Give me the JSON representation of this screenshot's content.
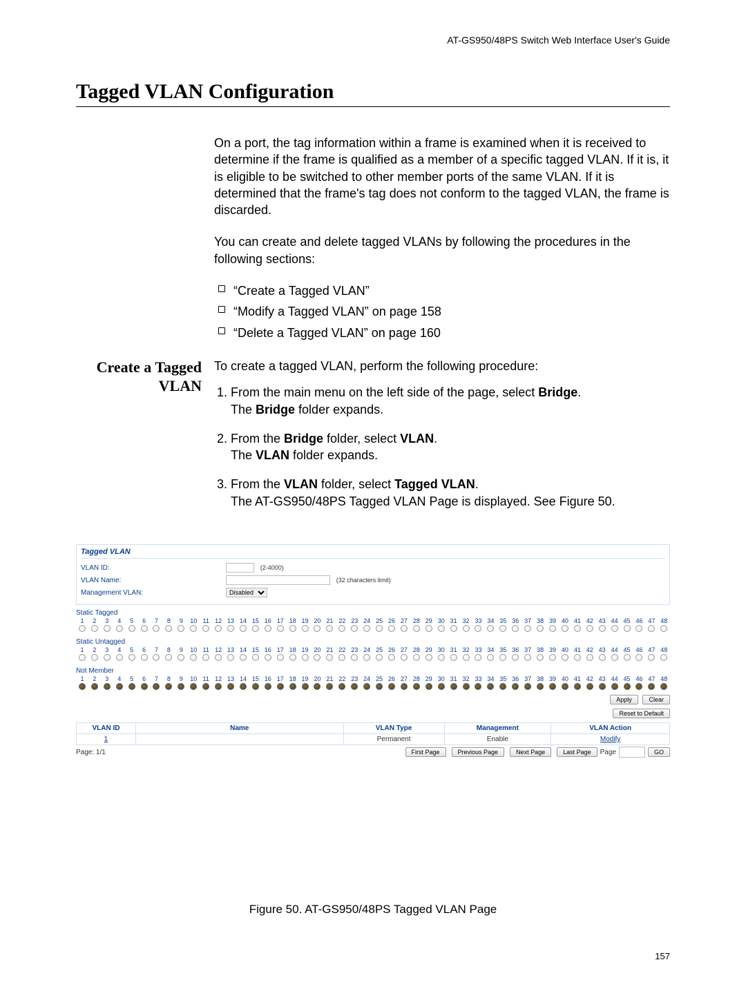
{
  "header": "AT-GS950/48PS Switch Web Interface User's Guide",
  "title": "Tagged VLAN Configuration",
  "intro1": "On a port, the tag information within a frame is examined when it is received to determine if the frame is qualified as a member of a specific tagged VLAN. If it is, it is eligible to be switched to other member ports of the same VLAN. If it is determined that the frame's tag does not conform to the tagged VLAN, the frame is discarded.",
  "intro2": "You can create and delete tagged VLANs by following the procedures in the following sections:",
  "bullets": [
    "“Create a Tagged VLAN”",
    "“Modify a Tagged VLAN” on page 158",
    "“Delete a Tagged VLAN” on page 160"
  ],
  "subhead": "Create a Tagged VLAN",
  "procedure_lead": "To create a tagged VLAN, perform the following procedure:",
  "steps": [
    {
      "a": "From the main menu on the left side of the page, select ",
      "b": "Bridge",
      "c": ".",
      "d": "The ",
      "e": "Bridge",
      "f": " folder expands."
    },
    {
      "a": "From the ",
      "b": "Bridge",
      "c": " folder, select ",
      "d": "VLAN",
      "e": ".",
      "f": "The ",
      "g": "VLAN",
      "h": " folder expands."
    },
    {
      "a": "From the ",
      "b": "VLAN",
      "c": " folder, select ",
      "d": "Tagged VLAN",
      "e": ".",
      "f": "The AT-GS950/48PS Tagged VLAN Page is displayed. See Figure 50."
    }
  ],
  "ui": {
    "panel_title": "Tagged VLAN",
    "fields": {
      "vlan_id": {
        "label": "VLAN ID:",
        "hint": "(2-4000)"
      },
      "vlan_name": {
        "label": "VLAN Name:",
        "hint": "(32 characters limit)"
      },
      "mgmt": {
        "label": "Management VLAN:",
        "value": "Disabled"
      }
    },
    "sections": {
      "tagged": "Static Tagged",
      "untagged": "Static Untagged",
      "notmember": "Not Member"
    },
    "ports": [
      1,
      2,
      3,
      4,
      5,
      6,
      7,
      8,
      9,
      10,
      11,
      12,
      13,
      14,
      15,
      16,
      17,
      18,
      19,
      20,
      21,
      22,
      23,
      24,
      25,
      26,
      27,
      28,
      29,
      30,
      31,
      32,
      33,
      34,
      35,
      36,
      37,
      38,
      39,
      40,
      41,
      42,
      43,
      44,
      45,
      46,
      47,
      48
    ],
    "btn_apply": "Apply",
    "btn_clear": "Clear",
    "btn_reset": "Reset to Default",
    "table": {
      "headers": [
        "VLAN ID",
        "Name",
        "VLAN Type",
        "Management",
        "VLAN Action"
      ],
      "row": {
        "id": "1",
        "name": "",
        "type": "Permanent",
        "mgmt": "Enable",
        "action": "Modify"
      }
    },
    "pager": {
      "label": "Page:  1/1",
      "first": "First Page",
      "prev": "Previous Page",
      "next": "Next Page",
      "last": "Last Page",
      "page_lbl": "Page",
      "go": "GO"
    }
  },
  "figure_caption": "Figure 50. AT-GS950/48PS Tagged VLAN Page",
  "page_number": "157"
}
